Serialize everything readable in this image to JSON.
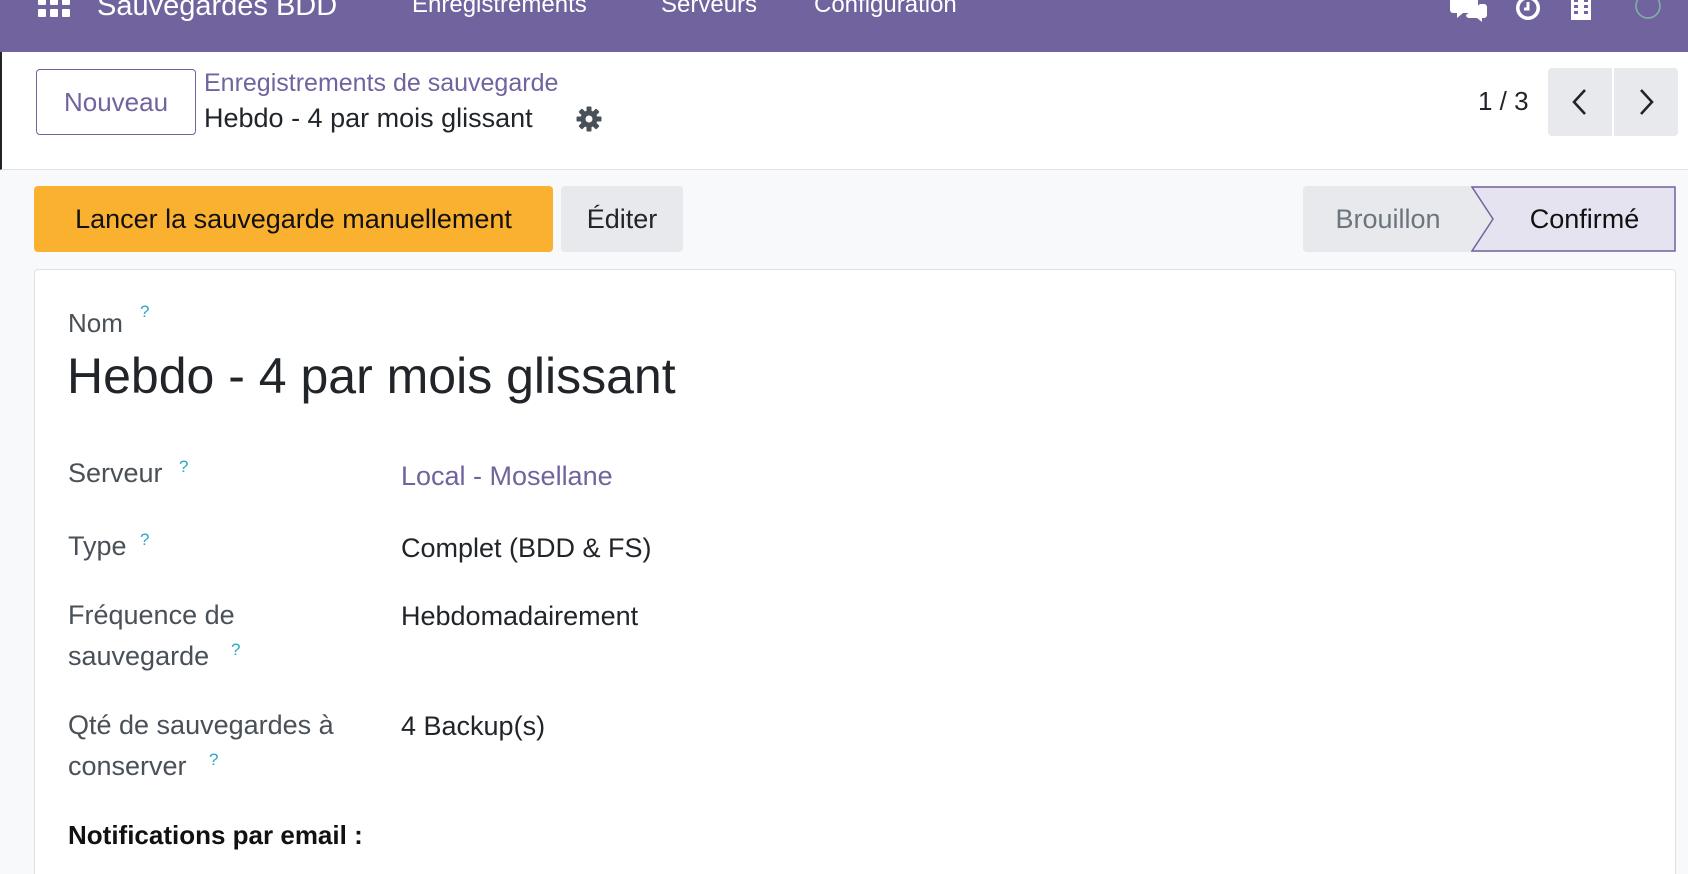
{
  "navbar": {
    "app_title": "Sauvegardes BDD",
    "menu": [
      "Enregistrements",
      "Serveurs",
      "Configuration"
    ],
    "right_icons": [
      "chat-icon",
      "clock-icon",
      "building-icon",
      "user-avatar"
    ],
    "color": "#71639e"
  },
  "control_panel": {
    "new_label": "Nouveau",
    "breadcrumb_parent": "Enregistrements de sauvegarde",
    "breadcrumb_current": "Hebdo - 4 par mois glissant",
    "pager": "1 / 3"
  },
  "actions": {
    "run_label": "Lancer la sauvegarde manuellement",
    "edit_label": "Éditer",
    "statuses": [
      "Brouillon",
      "Confirmé"
    ],
    "current_status": "Confirmé"
  },
  "form": {
    "name_label": "Nom",
    "name_value": "Hebdo - 4 par mois glissant",
    "help_mark": "?",
    "fields": [
      {
        "label_line1": "Serveur",
        "label_line2": "",
        "value": "Local - Mosellane",
        "is_link": true
      },
      {
        "label_line1": "Type",
        "label_line2": "",
        "value": "Complet (BDD & FS)",
        "is_link": false
      },
      {
        "label_line1": "Fréquence de",
        "label_line2": "sauvegarde",
        "value": "Hebdomadairement",
        "is_link": false
      },
      {
        "label_line1": "Qté de sauvegardes à",
        "label_line2": "conserver",
        "value": "4 Backup(s)",
        "is_link": false
      }
    ],
    "section_title": "Notifications par email :"
  },
  "colors": {
    "primary": "#71639e",
    "warning": "#fbb130",
    "help": "#2aa7c9"
  }
}
